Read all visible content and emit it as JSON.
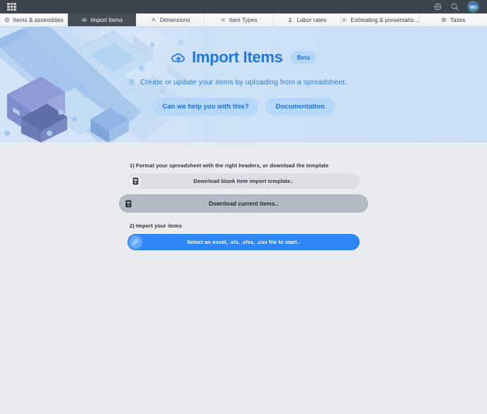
{
  "topbar": {
    "apps_menu_label": "apps-menu",
    "help_icon": "help-circle-icon",
    "search_icon": "search-icon",
    "avatar_label": "user-avatar"
  },
  "tabs": [
    {
      "label": "Items & assemblies",
      "icon": "box-icon",
      "active": false
    },
    {
      "label": "Import Items",
      "icon": "cloud-upload-icon",
      "active": true
    },
    {
      "label": "Dimensions",
      "icon": "ruler-icon",
      "active": false
    },
    {
      "label": "Item Types",
      "icon": "list-icon",
      "active": false
    },
    {
      "label": "Labor rates",
      "icon": "person-icon",
      "active": false
    },
    {
      "label": "Estimating & presentatio...",
      "icon": "gear-icon",
      "active": false
    },
    {
      "label": "Taxes",
      "icon": "bank-icon",
      "active": false
    }
  ],
  "hero": {
    "title": "Import Items",
    "badge": "Beta",
    "subtitle": "Create or update your items by uploading from a spreadsheet.",
    "help_button": "Can we help you with this?",
    "docs_button": "Documentation",
    "title_color": "#2176e0",
    "badge_bg": "#b4d6f7",
    "background_color": "#cfe2f6"
  },
  "main": {
    "step1_label": "1) Format your spreadsheet with the right headers, or download the template",
    "download_template_button": "Download blank item import template..",
    "download_current_button": "Download current items..",
    "step2_label": "2) Import your items",
    "select_file_button": "Select an excel, .xls, .xlsx, .csv file to start..",
    "primary_color": "#2f86f6",
    "hover_color": "#b3bac5"
  }
}
